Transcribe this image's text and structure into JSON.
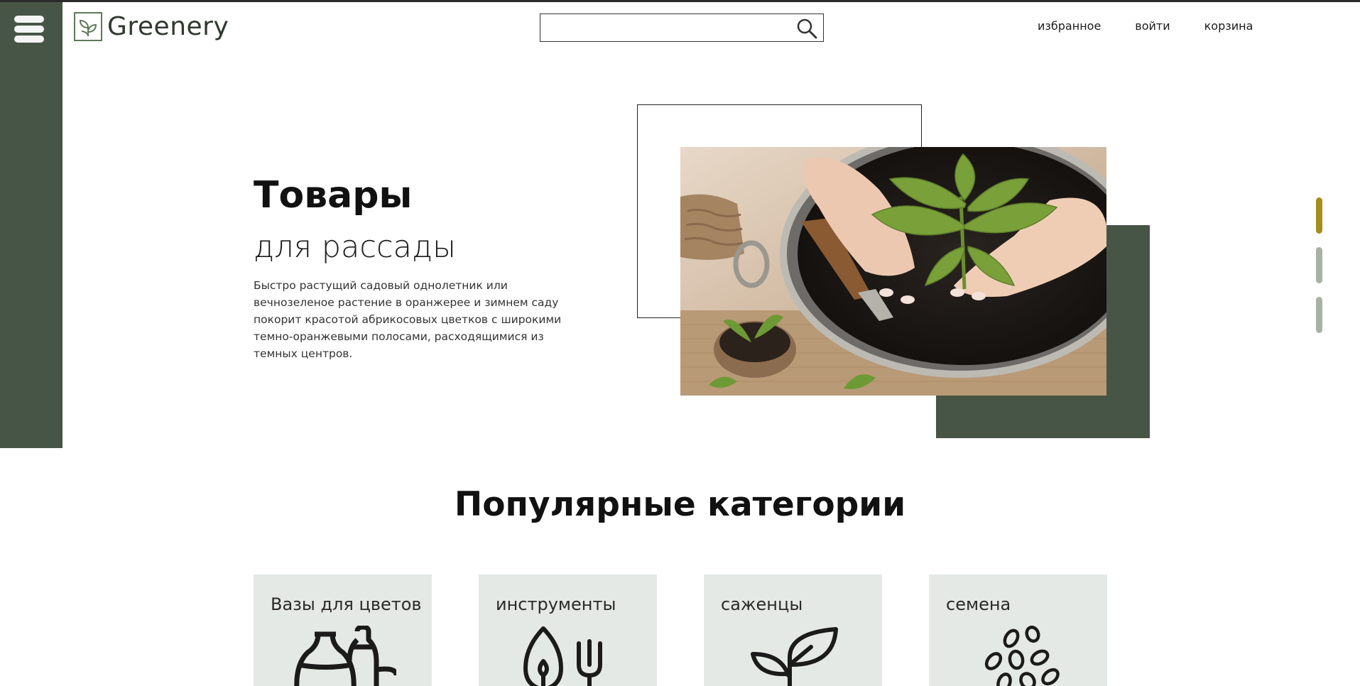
{
  "header": {
    "logo_text": "Greenery",
    "search": {
      "value": "",
      "placeholder": ""
    },
    "nav": {
      "favorites": "избранное",
      "login": "войти",
      "cart": "корзина"
    }
  },
  "hero": {
    "title": "Товары",
    "subtitle": "для рассады",
    "description": "Быстро растущий садовый однолетник или вечнозеленое растение в оранжерее и зимнем саду покорит красотой абрикосовых цветков с широкими темно-оранжевыми полосами, расходящимися из темных центров.",
    "slider": {
      "slides": 3,
      "active": 1
    }
  },
  "categories": {
    "title": "Популярные категории",
    "items": [
      {
        "label": "Вазы для цветов",
        "icon": "vases-icon"
      },
      {
        "label": "инструменты",
        "icon": "garden-tools-icon"
      },
      {
        "label": "саженцы",
        "icon": "sprout-icon"
      },
      {
        "label": "семена",
        "icon": "seeds-icon"
      }
    ]
  },
  "colors": {
    "brand_green": "#475546",
    "accent_gold": "#a68e1e",
    "inactive_dot": "#a9b1a6",
    "card_bg": "#e5e9e5"
  }
}
